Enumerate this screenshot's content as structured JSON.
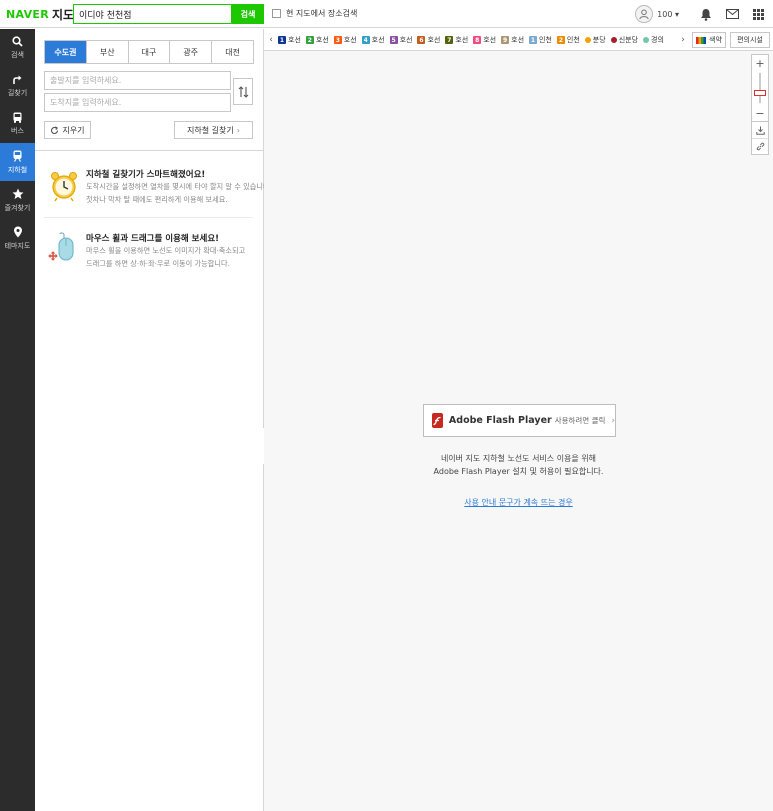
{
  "header": {
    "logo_brand": "NAVER",
    "logo_service": "지도",
    "search_value": "이디야 천천점",
    "search_button": "검색",
    "scope_label": "현 지도에서 장소검색",
    "notification_count": "100"
  },
  "nav": {
    "items": [
      {
        "label": "검색",
        "icon": "search-icon"
      },
      {
        "label": "길찾기",
        "icon": "directions-icon"
      },
      {
        "label": "버스",
        "icon": "bus-icon"
      },
      {
        "label": "지하철",
        "icon": "subway-icon",
        "active": true
      },
      {
        "label": "즐겨찾기",
        "icon": "star-icon"
      },
      {
        "label": "테마지도",
        "icon": "pin-icon"
      }
    ]
  },
  "panel": {
    "region_tabs": [
      "수도권",
      "부산",
      "대구",
      "광주",
      "대전"
    ],
    "active_region": "수도권",
    "origin_placeholder": "출발지를 입력하세요.",
    "destination_placeholder": "도착지를 입력하세요.",
    "reset_label": "지우기",
    "find_route_label": "지하철 길찾기",
    "tips": [
      {
        "icon": "alarm-clock-icon",
        "title": "지하철 길찾기가 스마트해졌어요!",
        "lines": [
          "도착시간을 설정하면 열차를 몇시에 타야 할지 알 수 있습니다.",
          "첫차나 막차 탈 때에도 편리하게 이용해 보세요."
        ]
      },
      {
        "icon": "mouse-icon",
        "title": "마우스 휠과 드래그를 이용해 보세요!",
        "lines": [
          "마우스 휠을 이용하면 노선도 이미지가 확대·축소되고",
          "드래그를 하면 상·하·좌·우로 이동이 가능합니다."
        ]
      }
    ]
  },
  "linebar": {
    "lines": [
      {
        "badge": "1",
        "label": "호선",
        "color": "#0d3692"
      },
      {
        "badge": "2",
        "label": "호선",
        "color": "#33a23d"
      },
      {
        "badge": "3",
        "label": "호선",
        "color": "#fe5b10"
      },
      {
        "badge": "4",
        "label": "호선",
        "color": "#32a1c8"
      },
      {
        "badge": "5",
        "label": "호선",
        "color": "#8b50a4"
      },
      {
        "badge": "6",
        "label": "호선",
        "color": "#c55c1d"
      },
      {
        "badge": "7",
        "label": "호선",
        "color": "#54640d"
      },
      {
        "badge": "8",
        "label": "호선",
        "color": "#f14c82"
      },
      {
        "badge": "9",
        "label": "호선",
        "color": "#aa9872"
      },
      {
        "badge": "1",
        "label": "인천",
        "color": "#7ca8d5"
      },
      {
        "badge": "2",
        "label": "인천",
        "color": "#ed8b00"
      },
      {
        "badge": "",
        "label": "분당",
        "color": "#f5a200"
      },
      {
        "badge": "",
        "label": "신분당",
        "color": "#a71e31"
      },
      {
        "badge": "",
        "label": "경의",
        "color": "#73c7a6"
      }
    ],
    "route_map_label": "색약",
    "facility_label": "편의시설"
  },
  "map": {
    "flash_product": "Adobe Flash Player",
    "flash_action": "사용하려면 클릭",
    "message_line1": "네이버 지도 지하철 노선도 서비스 이용을 위해",
    "message_line2": "Adobe Flash Player 설치 및 허용이 필요합니다.",
    "help_link": "사용 안내 문구가 계속 뜨는 경우"
  },
  "colors": {
    "brand_green": "#1ec800",
    "active_blue": "#2c7bd8",
    "nav_bg": "#2c2c2c"
  }
}
